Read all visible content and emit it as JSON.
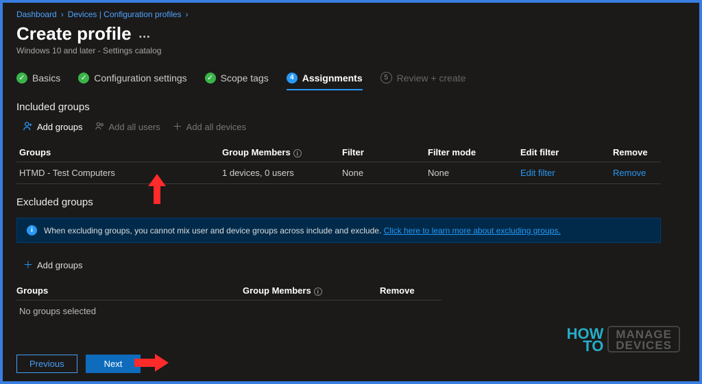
{
  "breadcrumb": {
    "items": [
      "Dashboard",
      "Devices | Configuration profiles"
    ]
  },
  "page": {
    "title": "Create profile",
    "subtitle": "Windows 10 and later - Settings catalog"
  },
  "steps": [
    {
      "label": "Basics",
      "state": "done"
    },
    {
      "label": "Configuration settings",
      "state": "done"
    },
    {
      "label": "Scope tags",
      "state": "done"
    },
    {
      "label": "Assignments",
      "state": "active",
      "num": "4"
    },
    {
      "label": "Review + create",
      "state": "disabled",
      "num": "5"
    }
  ],
  "included": {
    "title": "Included groups",
    "actions": {
      "add_groups": "Add groups",
      "add_all_users": "Add all users",
      "add_all_devices": "Add all devices"
    },
    "headers": {
      "group": "Groups",
      "members": "Group Members",
      "filter": "Filter",
      "filter_mode": "Filter mode",
      "edit_filter": "Edit filter",
      "remove": "Remove"
    },
    "rows": [
      {
        "group": "HTMD - Test Computers",
        "members": "1 devices, 0 users",
        "filter": "None",
        "filter_mode": "None",
        "edit_filter": "Edit filter",
        "remove": "Remove"
      }
    ]
  },
  "excluded": {
    "title": "Excluded groups",
    "infobox": {
      "text": "When excluding groups, you cannot mix user and device groups across include and exclude.",
      "link": "Click here to learn more about excluding groups."
    },
    "add_groups": "Add groups",
    "headers": {
      "group": "Groups",
      "members": "Group Members",
      "remove": "Remove"
    },
    "empty": "No groups selected"
  },
  "footer": {
    "previous": "Previous",
    "next": "Next"
  },
  "watermark": {
    "how": "HOW",
    "to": "TO",
    "manage": "MANAGE",
    "devices": "DEVICES"
  }
}
